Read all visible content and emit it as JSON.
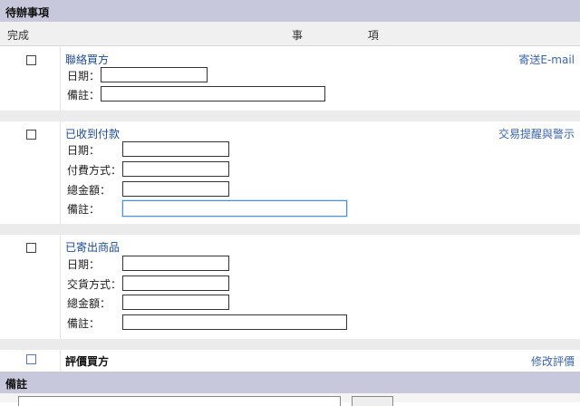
{
  "header": {
    "title": "待辦事項"
  },
  "columns": {
    "done": "完成",
    "item": "事 項"
  },
  "sections": [
    {
      "title": "聯絡買方",
      "action": "寄送E-mail",
      "fields": [
        {
          "label": "日期："
        },
        {
          "label": "備註："
        }
      ]
    },
    {
      "title": "已收到付款",
      "action": "交易提醒與警示",
      "fields": [
        {
          "label": "日期："
        },
        {
          "label": "付費方式："
        },
        {
          "label": "總金額："
        },
        {
          "label": "備註："
        }
      ]
    },
    {
      "title": "已寄出商品",
      "action": "",
      "fields": [
        {
          "label": "日期："
        },
        {
          "label": "交貨方式："
        },
        {
          "label": "總金額："
        },
        {
          "label": "備註："
        }
      ]
    },
    {
      "title": "評價買方",
      "action": "修改評價",
      "fields": []
    }
  ],
  "notes": {
    "title": "備註"
  }
}
